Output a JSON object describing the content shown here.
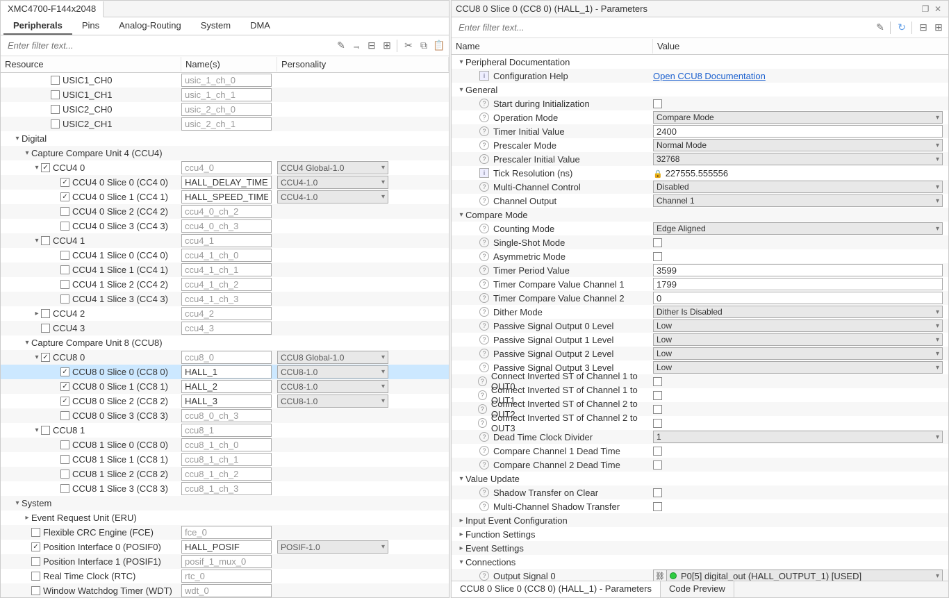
{
  "left": {
    "mainTab": "XMC4700-F144x2048",
    "subtabs": [
      "Peripherals",
      "Pins",
      "Analog-Routing",
      "System",
      "DMA"
    ],
    "filterPlaceholder": "Enter filter text...",
    "cols": {
      "res": "Resource",
      "name": "Name(s)",
      "pers": "Personality"
    },
    "rows": [
      {
        "indent": 4,
        "check": false,
        "label": "USIC1_CH0",
        "name": "usic_1_ch_0",
        "ph": true
      },
      {
        "indent": 4,
        "check": false,
        "label": "USIC1_CH1",
        "name": "usic_1_ch_1",
        "ph": true,
        "alt": true
      },
      {
        "indent": 4,
        "check": false,
        "label": "USIC2_CH0",
        "name": "usic_2_ch_0",
        "ph": true
      },
      {
        "indent": 4,
        "check": false,
        "label": "USIC2_CH1",
        "name": "usic_2_ch_1",
        "ph": true,
        "alt": true
      },
      {
        "indent": 1,
        "exp": "▾",
        "label": "Digital",
        "group": true
      },
      {
        "indent": 2,
        "exp": "▾",
        "label": "Capture Compare Unit 4 (CCU4)",
        "group": true,
        "alt": true
      },
      {
        "indent": 3,
        "exp": "▾",
        "check": true,
        "label": "CCU4 0",
        "name": "ccu4_0",
        "ph": true,
        "pers": "CCU4 Global-1.0"
      },
      {
        "indent": 5,
        "check": true,
        "label": "CCU4 0 Slice 0 (CC4 0)",
        "name": "HALL_DELAY_TIMER",
        "pers": "CCU4-1.0",
        "alt": true
      },
      {
        "indent": 5,
        "check": true,
        "label": "CCU4 0 Slice 1 (CC4 1)",
        "name": "HALL_SPEED_TIMER",
        "pers": "CCU4-1.0"
      },
      {
        "indent": 5,
        "check": false,
        "label": "CCU4 0 Slice 2 (CC4 2)",
        "name": "ccu4_0_ch_2",
        "ph": true,
        "alt": true
      },
      {
        "indent": 5,
        "check": false,
        "label": "CCU4 0 Slice 3 (CC4 3)",
        "name": "ccu4_0_ch_3",
        "ph": true
      },
      {
        "indent": 3,
        "exp": "▾",
        "check": false,
        "label": "CCU4 1",
        "name": "ccu4_1",
        "ph": true,
        "alt": true
      },
      {
        "indent": 5,
        "check": false,
        "label": "CCU4 1 Slice 0 (CC4 0)",
        "name": "ccu4_1_ch_0",
        "ph": true
      },
      {
        "indent": 5,
        "check": false,
        "label": "CCU4 1 Slice 1 (CC4 1)",
        "name": "ccu4_1_ch_1",
        "ph": true,
        "alt": true
      },
      {
        "indent": 5,
        "check": false,
        "label": "CCU4 1 Slice 2 (CC4 2)",
        "name": "ccu4_1_ch_2",
        "ph": true
      },
      {
        "indent": 5,
        "check": false,
        "label": "CCU4 1 Slice 3 (CC4 3)",
        "name": "ccu4_1_ch_3",
        "ph": true,
        "alt": true
      },
      {
        "indent": 3,
        "exp": "▸",
        "check": false,
        "label": "CCU4 2",
        "name": "ccu4_2",
        "ph": true
      },
      {
        "indent": 3,
        "check": false,
        "label": "CCU4 3",
        "name": "ccu4_3",
        "ph": true,
        "alt": true
      },
      {
        "indent": 2,
        "exp": "▾",
        "label": "Capture Compare Unit 8 (CCU8)",
        "group": true
      },
      {
        "indent": 3,
        "exp": "▾",
        "check": true,
        "label": "CCU8 0",
        "name": "ccu8_0",
        "ph": true,
        "pers": "CCU8 Global-1.0",
        "alt": true
      },
      {
        "indent": 5,
        "check": true,
        "label": "CCU8 0 Slice 0 (CC8 0)",
        "name": "HALL_1",
        "pers": "CCU8-1.0",
        "sel": true
      },
      {
        "indent": 5,
        "check": true,
        "label": "CCU8 0 Slice 1 (CC8 1)",
        "name": "HALL_2",
        "pers": "CCU8-1.0",
        "alt": true
      },
      {
        "indent": 5,
        "check": true,
        "label": "CCU8 0 Slice 2 (CC8 2)",
        "name": "HALL_3",
        "pers": "CCU8-1.0"
      },
      {
        "indent": 5,
        "check": false,
        "label": "CCU8 0 Slice 3 (CC8 3)",
        "name": "ccu8_0_ch_3",
        "ph": true,
        "alt": true
      },
      {
        "indent": 3,
        "exp": "▾",
        "check": false,
        "label": "CCU8 1",
        "name": "ccu8_1",
        "ph": true
      },
      {
        "indent": 5,
        "check": false,
        "label": "CCU8 1 Slice 0 (CC8 0)",
        "name": "ccu8_1_ch_0",
        "ph": true,
        "alt": true
      },
      {
        "indent": 5,
        "check": false,
        "label": "CCU8 1 Slice 1 (CC8 1)",
        "name": "ccu8_1_ch_1",
        "ph": true
      },
      {
        "indent": 5,
        "check": false,
        "label": "CCU8 1 Slice 2 (CC8 2)",
        "name": "ccu8_1_ch_2",
        "ph": true,
        "alt": true
      },
      {
        "indent": 5,
        "check": false,
        "label": "CCU8 1 Slice 3 (CC8 3)",
        "name": "ccu8_1_ch_3",
        "ph": true
      },
      {
        "indent": 1,
        "exp": "▾",
        "label": "System",
        "group": true,
        "alt": true
      },
      {
        "indent": 2,
        "exp": "▸",
        "label": "Event Request Unit (ERU)",
        "group": true
      },
      {
        "indent": 2,
        "check": false,
        "label": "Flexible CRC Engine (FCE)",
        "name": "fce_0",
        "ph": true,
        "alt": true
      },
      {
        "indent": 2,
        "check": true,
        "label": "Position Interface 0 (POSIF0)",
        "name": "HALL_POSIF",
        "pers": "POSIF-1.0"
      },
      {
        "indent": 2,
        "check": false,
        "label": "Position Interface 1 (POSIF1)",
        "name": "posif_1_mux_0",
        "ph": true,
        "alt": true
      },
      {
        "indent": 2,
        "check": false,
        "label": "Real Time Clock (RTC)",
        "name": "rtc_0",
        "ph": true
      },
      {
        "indent": 2,
        "check": false,
        "label": "Window Watchdog Timer (WDT)",
        "name": "wdt_0",
        "ph": true,
        "alt": true
      }
    ]
  },
  "right": {
    "title": "CCU8 0 Slice 0 (CC8 0) (HALL_1) - Parameters",
    "filterUisc": "Enter filter text...",
    "cols": {
      "name": "Name",
      "val": "Value"
    },
    "rows": [
      {
        "indent": 0,
        "exp": "▾",
        "label": "Peripheral Documentation",
        "group": true
      },
      {
        "indent": 2,
        "info": true,
        "label": "Configuration Help",
        "link": "Open CCU8 Documentation",
        "alt": true
      },
      {
        "indent": 0,
        "exp": "▾",
        "label": "General",
        "group": true
      },
      {
        "indent": 2,
        "help": true,
        "label": "Start during Initialization",
        "ctl": "check",
        "alt": true
      },
      {
        "indent": 2,
        "help": true,
        "label": "Operation Mode",
        "ctl": "sel",
        "val": "Compare Mode"
      },
      {
        "indent": 2,
        "help": true,
        "label": "Timer Initial Value",
        "ctl": "text",
        "val": "2400",
        "alt": true
      },
      {
        "indent": 2,
        "help": true,
        "label": "Prescaler Mode",
        "ctl": "sel",
        "val": "Normal Mode"
      },
      {
        "indent": 2,
        "help": true,
        "label": "Prescaler Initial Value",
        "ctl": "sel",
        "val": "32768",
        "alt": true
      },
      {
        "indent": 2,
        "info": true,
        "label": "Tick Resolution (ns)",
        "ctl": "lock",
        "val": "227555.555556"
      },
      {
        "indent": 2,
        "help": true,
        "label": "Multi-Channel Control",
        "ctl": "sel",
        "val": "Disabled",
        "alt": true
      },
      {
        "indent": 2,
        "help": true,
        "label": "Channel Output",
        "ctl": "sel",
        "val": "Channel 1"
      },
      {
        "indent": 0,
        "exp": "▾",
        "label": "Compare Mode",
        "group": true,
        "alt": true
      },
      {
        "indent": 2,
        "help": true,
        "label": "Counting Mode",
        "ctl": "sel",
        "val": "Edge Aligned"
      },
      {
        "indent": 2,
        "help": true,
        "label": "Single-Shot Mode",
        "ctl": "check",
        "alt": true
      },
      {
        "indent": 2,
        "help": true,
        "label": "Asymmetric Mode",
        "ctl": "check"
      },
      {
        "indent": 2,
        "help": true,
        "label": "Timer Period Value",
        "ctl": "text",
        "val": "3599",
        "alt": true
      },
      {
        "indent": 2,
        "help": true,
        "label": "Timer Compare Value Channel 1",
        "ctl": "text",
        "val": "1799"
      },
      {
        "indent": 2,
        "help": true,
        "label": "Timer Compare Value Channel 2",
        "ctl": "text",
        "val": "0",
        "alt": true
      },
      {
        "indent": 2,
        "help": true,
        "label": "Dither Mode",
        "ctl": "sel",
        "val": "Dither Is Disabled"
      },
      {
        "indent": 2,
        "help": true,
        "label": "Passive Signal Output 0 Level",
        "ctl": "sel",
        "val": "Low",
        "alt": true
      },
      {
        "indent": 2,
        "help": true,
        "label": "Passive Signal Output 1 Level",
        "ctl": "sel",
        "val": "Low"
      },
      {
        "indent": 2,
        "help": true,
        "label": "Passive Signal Output 2 Level",
        "ctl": "sel",
        "val": "Low",
        "alt": true
      },
      {
        "indent": 2,
        "help": true,
        "label": "Passive Signal Output 3 Level",
        "ctl": "sel",
        "val": "Low"
      },
      {
        "indent": 2,
        "help": true,
        "label": "Connect Inverted ST of Channel 1 to OUT0",
        "ctl": "check",
        "alt": true
      },
      {
        "indent": 2,
        "help": true,
        "label": "Connect Inverted ST of Channel 1 to OUT1",
        "ctl": "check"
      },
      {
        "indent": 2,
        "help": true,
        "label": "Connect Inverted ST of Channel 2 to OUT2",
        "ctl": "check",
        "alt": true
      },
      {
        "indent": 2,
        "help": true,
        "label": "Connect Inverted ST of Channel 2 to OUT3",
        "ctl": "check"
      },
      {
        "indent": 2,
        "help": true,
        "label": "Dead Time Clock Divider",
        "ctl": "sel",
        "val": "1",
        "alt": true
      },
      {
        "indent": 2,
        "help": true,
        "label": "Compare Channel 1 Dead Time",
        "ctl": "check"
      },
      {
        "indent": 2,
        "help": true,
        "label": "Compare Channel 2 Dead Time",
        "ctl": "check",
        "alt": true
      },
      {
        "indent": 0,
        "exp": "▾",
        "label": "Value Update",
        "group": true
      },
      {
        "indent": 2,
        "help": true,
        "label": "Shadow Transfer on Clear",
        "ctl": "check",
        "alt": true
      },
      {
        "indent": 2,
        "help": true,
        "label": "Multi-Channel Shadow Transfer",
        "ctl": "check"
      },
      {
        "indent": 0,
        "exp": "▸",
        "label": "Input Event Configuration",
        "group": true,
        "alt": true
      },
      {
        "indent": 0,
        "exp": "▸",
        "label": "Function Settings",
        "group": true
      },
      {
        "indent": 0,
        "exp": "▸",
        "label": "Event Settings",
        "group": true,
        "alt": true
      },
      {
        "indent": 0,
        "exp": "▾",
        "label": "Connections",
        "group": true
      },
      {
        "indent": 2,
        "help": true,
        "label": "Output Signal 0",
        "ctl": "out",
        "val": "P0[5] digital_out (HALL_OUTPUT_1) [USED]",
        "alt": true
      }
    ],
    "bottomTabs": [
      "CCU8 0 Slice 0 (CC8 0) (HALL_1) - Parameters",
      "Code Preview"
    ]
  }
}
